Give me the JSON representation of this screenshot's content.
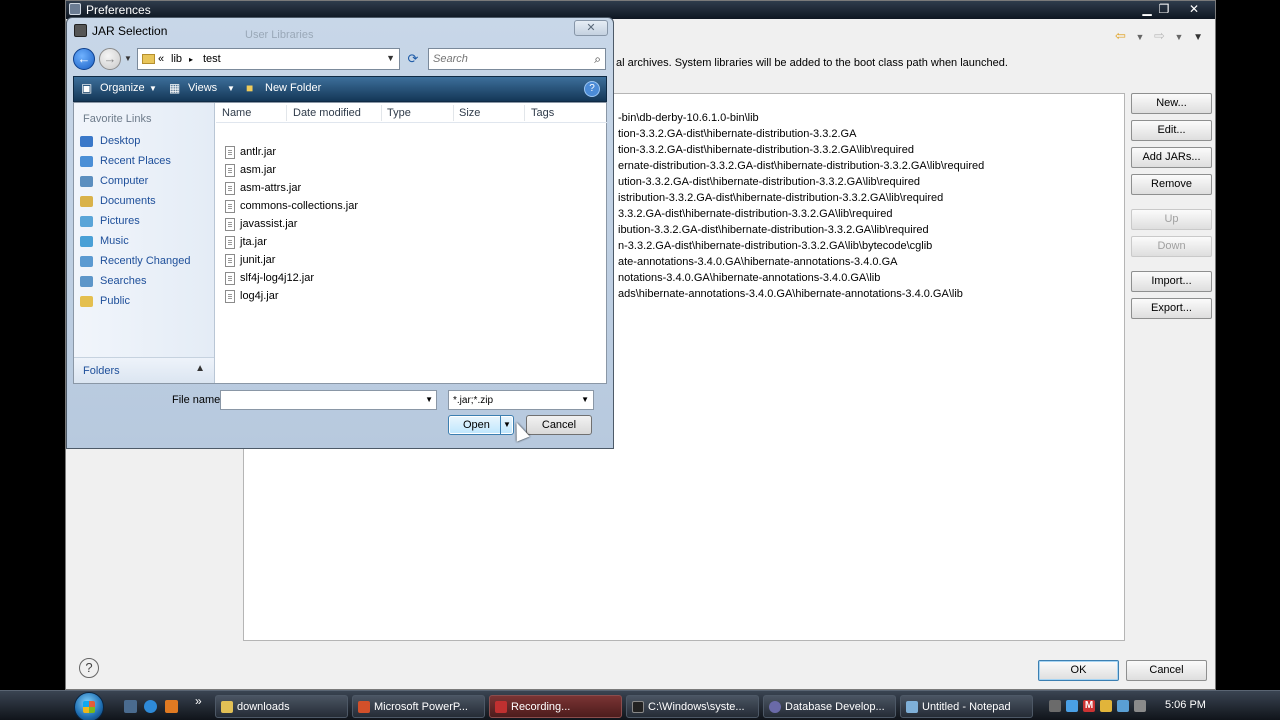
{
  "preferences": {
    "title": "Preferences",
    "description": "al archives. System libraries will be added to the boot class path when launched.",
    "library_rows": [
      "-bin\\db-derby-10.6.1.0-bin\\lib",
      "tion-3.3.2.GA-dist\\hibernate-distribution-3.3.2.GA",
      "tion-3.3.2.GA-dist\\hibernate-distribution-3.3.2.GA\\lib\\required",
      "ernate-distribution-3.3.2.GA-dist\\hibernate-distribution-3.3.2.GA\\lib\\required",
      "ution-3.3.2.GA-dist\\hibernate-distribution-3.3.2.GA\\lib\\required",
      "istribution-3.3.2.GA-dist\\hibernate-distribution-3.3.2.GA\\lib\\required",
      "3.3.2.GA-dist\\hibernate-distribution-3.3.2.GA\\lib\\required",
      "ibution-3.3.2.GA-dist\\hibernate-distribution-3.3.2.GA\\lib\\required",
      "n-3.3.2.GA-dist\\hibernate-distribution-3.3.2.GA\\lib\\bytecode\\cglib",
      "ate-annotations-3.4.0.GA\\hibernate-annotations-3.4.0.GA",
      "notations-3.4.0.GA\\hibernate-annotations-3.4.0.GA\\lib",
      "ads\\hibernate-annotations-3.4.0.GA\\hibernate-annotations-3.4.0.GA\\lib"
    ],
    "side_buttons": {
      "new": "New...",
      "edit": "Edit...",
      "add_jars": "Add JARs...",
      "remove": "Remove",
      "up": "Up",
      "down": "Down",
      "import": "Import...",
      "export": "Export..."
    },
    "ok": "OK",
    "cancel": "Cancel",
    "help_glyph": "?"
  },
  "dialog": {
    "title": "JAR Selection",
    "ghost_title": "User Libraries",
    "close_glyph": "✕",
    "address": {
      "overflow": "«",
      "crumbs": [
        "lib",
        "test"
      ],
      "sep": "▸"
    },
    "search_placeholder": "Search",
    "command_bar": {
      "organize": "Organize",
      "views": "Views",
      "new_folder": "New Folder",
      "help_glyph": "?"
    },
    "favorite_links_header": "Favorite Links",
    "favorite_links": [
      {
        "label": "Desktop",
        "icon": "desktop-icon",
        "color": "#3a78c9"
      },
      {
        "label": "Recent Places",
        "icon": "recent-places-icon",
        "color": "#4b8fd6"
      },
      {
        "label": "Computer",
        "icon": "computer-icon",
        "color": "#5c8fbf"
      },
      {
        "label": "Documents",
        "icon": "documents-icon",
        "color": "#d9b24a"
      },
      {
        "label": "Pictures",
        "icon": "pictures-icon",
        "color": "#5aa5d8"
      },
      {
        "label": "Music",
        "icon": "music-icon",
        "color": "#4aa0d6"
      },
      {
        "label": "Recently Changed",
        "icon": "recently-changed-icon",
        "color": "#5b9ad1"
      },
      {
        "label": "Searches",
        "icon": "searches-icon",
        "color": "#5d96c9"
      },
      {
        "label": "Public",
        "icon": "public-folder-icon",
        "color": "#e4bf4f"
      }
    ],
    "folders_label": "Folders",
    "columns": [
      "Name",
      "Date modified",
      "Type",
      "Size",
      "Tags"
    ],
    "files": [
      "antlr.jar",
      "asm.jar",
      "asm-attrs.jar",
      "commons-collections.jar",
      "javassist.jar",
      "jta.jar",
      "junit.jar",
      "slf4j-log4j12.jar",
      "log4j.jar"
    ],
    "file_name_label": "File name:",
    "file_name_value": "",
    "filter": "*.jar;*.zip",
    "open": "Open",
    "cancel": "Cancel"
  },
  "taskbar": {
    "tasks": [
      {
        "label": "downloads",
        "color": "#e2c055"
      },
      {
        "label": "Microsoft PowerP...",
        "color": "#d2502a"
      },
      {
        "label": "Recording...",
        "color": "#c03030"
      },
      {
        "label": "C:\\Windows\\syste...",
        "color": "#222222"
      },
      {
        "label": "Database Develop...",
        "color": "#6a6aa8"
      },
      {
        "label": "Untitled - Notepad",
        "color": "#7fb0d8"
      }
    ],
    "clock": "5:06 PM",
    "chevron": "»"
  }
}
